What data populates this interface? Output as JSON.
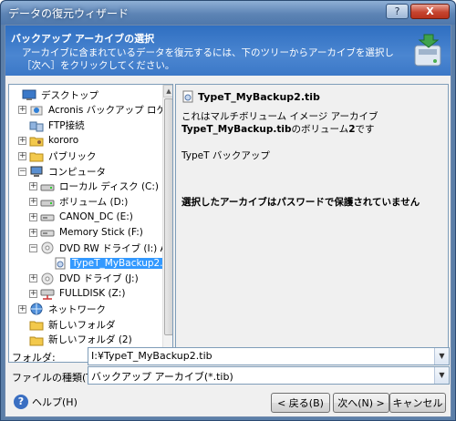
{
  "window": {
    "title": "データの復元ウィザード",
    "buttons": {
      "help": "?",
      "close": "X"
    }
  },
  "header": {
    "title": "バックアップ アーカイブの選択",
    "description": "アーカイブに含まれているデータを復元するには、下のツリーからアーカイブを選択し［次へ］をクリックしてください。"
  },
  "tree": {
    "items": [
      {
        "label": "デスクトップ",
        "icon": "desktop-icon",
        "expander": ""
      },
      {
        "label": "Acronis バックアップ ロケーション",
        "icon": "acronis-location-icon",
        "expander": "+"
      },
      {
        "label": "FTP接続",
        "icon": "ftp-icon",
        "expander": ""
      },
      {
        "label": "kororo",
        "icon": "user-folder-icon",
        "expander": "+"
      },
      {
        "label": "パブリック",
        "icon": "folder-icon",
        "expander": "+"
      },
      {
        "label": "コンピュータ",
        "icon": "computer-icon",
        "expander": "−"
      },
      {
        "label": "ローカル ディスク (C:)",
        "icon": "disk-icon",
        "expander": "+"
      },
      {
        "label": "ボリューム (D:)",
        "icon": "disk-icon",
        "expander": "+"
      },
      {
        "label": "CANON_DC (E:)",
        "icon": "removable-disk-icon",
        "expander": "+"
      },
      {
        "label": "Memory Stick (F:)",
        "icon": "removable-disk-icon",
        "expander": "+"
      },
      {
        "label": "DVD RW ドライブ (I:) Acronis",
        "icon": "dvd-icon",
        "expander": "−"
      },
      {
        "label": "TypeT_MyBackup2.tib",
        "icon": "archive-icon",
        "expander": ""
      },
      {
        "label": "DVD ドライブ (J:)",
        "icon": "dvd-icon",
        "expander": "+"
      },
      {
        "label": "FULLDISK (Z:)",
        "icon": "network-drive-icon",
        "expander": "+"
      },
      {
        "label": "ネットワーク",
        "icon": "network-icon",
        "expander": "+"
      },
      {
        "label": "新しいフォルダ",
        "icon": "folder-icon",
        "expander": ""
      },
      {
        "label": "新しいフォルダ (2)",
        "icon": "folder-icon",
        "expander": ""
      }
    ]
  },
  "info": {
    "archive_name": "TypeT_MyBackup2.tib",
    "line1": "これはマルチボリューム イメージ アーカイブ",
    "line2_bold": "TypeT_MyBackup.tib",
    "line2_rest": "のボリューム",
    "line2_num": "2",
    "line2_end": "です",
    "comment": "TypeT バックアップ",
    "password_note": "選択したアーカイブはパスワードで保護されていません"
  },
  "folder": {
    "label": "フォルダ:",
    "value": "I:¥TypeT_MyBackup2.tib"
  },
  "file_type": {
    "label": "ファイルの種類(T):",
    "value": "バックアップ アーカイブ(*.tib)"
  },
  "footer": {
    "help": "ヘルプ(H)",
    "back": "< 戻る(B)",
    "next": "次へ(N) >",
    "cancel": "キャンセル"
  }
}
